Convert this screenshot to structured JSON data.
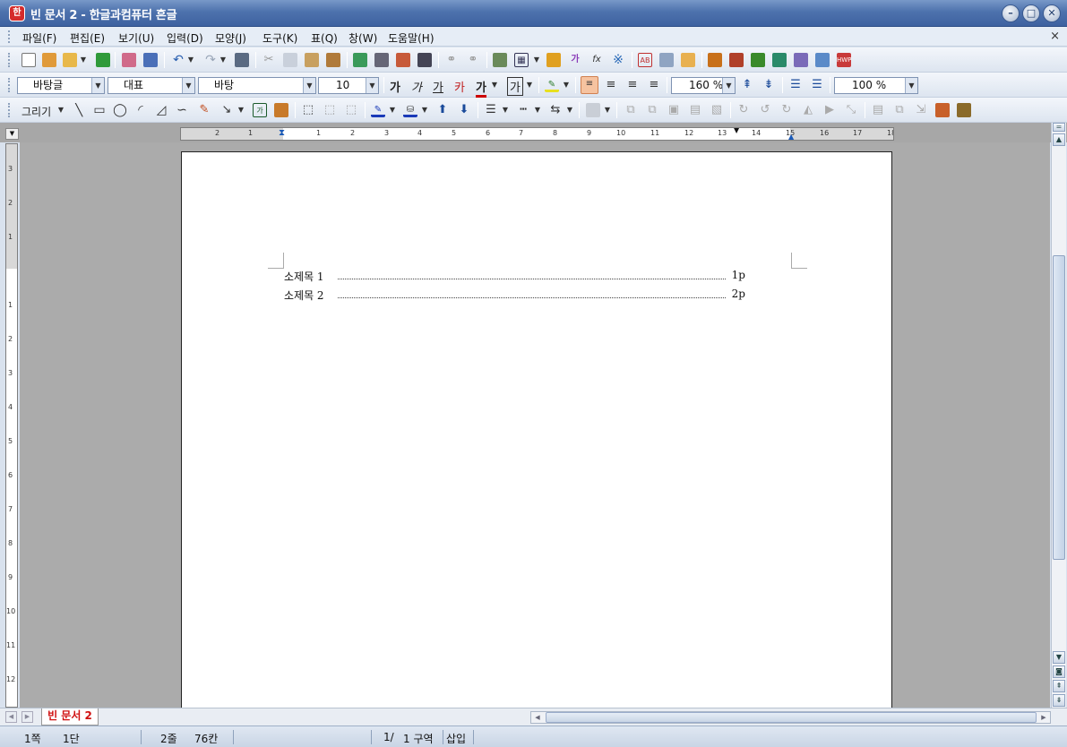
{
  "window": {
    "title": "빈 문서 2 - 한글과컴퓨터 흔글",
    "app_icon_glyph": "한"
  },
  "menu": {
    "items": [
      "파일(F)",
      "편집(E)",
      "보기(U)",
      "입력(D)",
      "모양(J)",
      "도구(K)",
      "표(Q)",
      "창(W)",
      "도움말(H)"
    ],
    "close_glyph": "×"
  },
  "format_bar": {
    "style": "바탕글",
    "font_lang": "대표",
    "font_name": "바탕",
    "font_size": "10",
    "bold": "가",
    "italic": "가",
    "underline": "가",
    "strike": "카",
    "text_color": "가",
    "shade": "가",
    "line_spacing": "160 %",
    "zoom": "100 %"
  },
  "draw_bar": {
    "label": "그리기"
  },
  "ruler": {
    "h_ticks": [
      "2",
      "1",
      "1",
      "2",
      "3",
      "4",
      "5",
      "6",
      "7",
      "8",
      "9",
      "10",
      "11",
      "12",
      "13",
      "14",
      "15",
      "16",
      "17",
      "18"
    ],
    "v_ticks": [
      "3",
      "2",
      "1",
      "1",
      "2",
      "3",
      "4",
      "5",
      "6",
      "7",
      "8",
      "9",
      "10",
      "11",
      "12"
    ]
  },
  "document": {
    "toc": [
      {
        "label": "소제목 1",
        "page": "1p"
      },
      {
        "label": "소제목 2",
        "page": "2p"
      }
    ]
  },
  "tabs": {
    "active": "빈 문서 2"
  },
  "status": {
    "page": "1쪽",
    "column": "1단",
    "line": "2줄",
    "col_pos": "76칸",
    "section_left": "1/",
    "section_right": "1 구역",
    "mode": "삽입"
  },
  "colors": {
    "title_bar": "#4d72ad",
    "accent_red": "#d01010",
    "workspace": "#ababab"
  }
}
